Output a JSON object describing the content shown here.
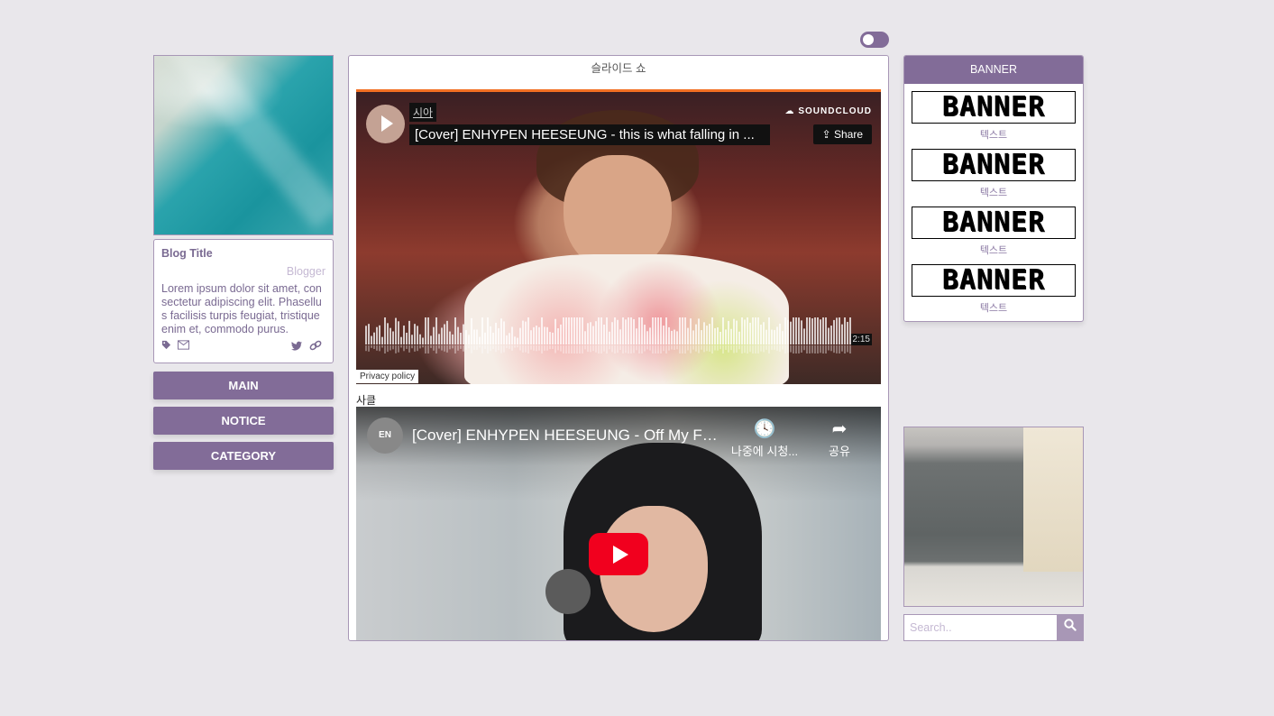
{
  "toggle": {
    "state": "off"
  },
  "left": {
    "blog_title": "Blog Title",
    "blogger": "Blogger",
    "description": "Lorem ipsum dolor sit amet, consectetur adipiscing elit. Phasellus facilisis turpis feugiat, tristique enim et, commodo purus.",
    "nav": [
      "MAIN",
      "NOTICE",
      "CATEGORY"
    ]
  },
  "center": {
    "slideshow_title": "슬라이드 쇼",
    "soundcloud": {
      "artist": "시아",
      "track": "[Cover] ENHYPEN HEESEUNG - this is what falling in ...",
      "logo": "SOUNDCLOUD",
      "share": "Share",
      "duration": "2:15",
      "privacy": "Privacy policy"
    },
    "caption": "사클",
    "youtube": {
      "channel": "EN",
      "title": "[Cover] ENHYPEN HEESEUNG - Off My Fa...",
      "watch_later": "나중에 시청...",
      "share": "공유"
    }
  },
  "right": {
    "banner_header": "BANNER",
    "banners": [
      {
        "image_text": "BANNER",
        "label": "텍스트"
      },
      {
        "image_text": "BANNER",
        "label": "텍스트"
      },
      {
        "image_text": "BANNER",
        "label": "텍스트"
      },
      {
        "image_text": "BANNER",
        "label": "텍스트"
      }
    ],
    "search_placeholder": "Search.."
  },
  "colors": {
    "accent": "#826c98",
    "background": "#e9e7eb",
    "border": "#a897b6",
    "soundcloud_orange": "#f26f23",
    "youtube_red": "#f1001e"
  }
}
